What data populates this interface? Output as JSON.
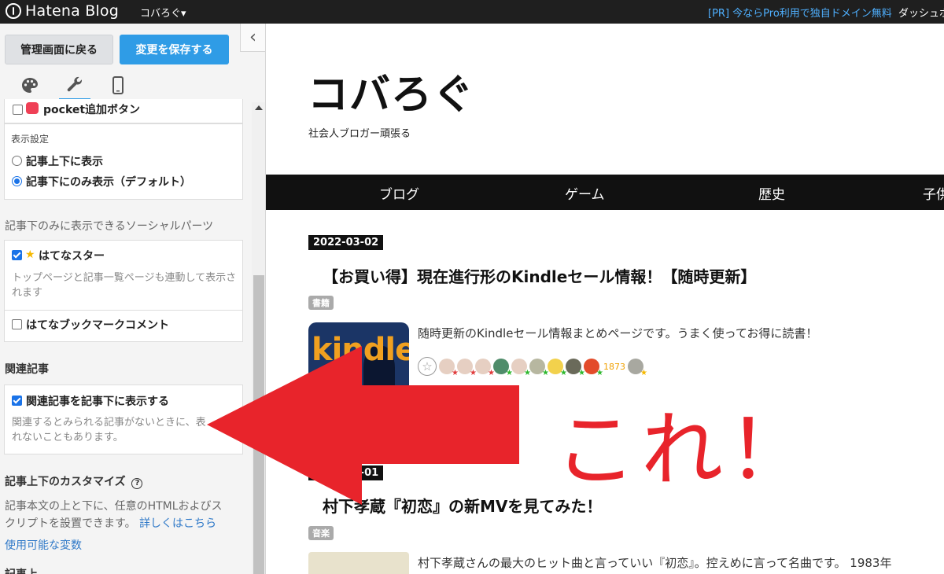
{
  "topbar": {
    "logo_text": "Hatena Blog",
    "blog_switch": "コバろぐ▾",
    "pr_link": "[PR] 今ならPro利用で独自ドメイン無料",
    "dashboard_link": "ダッシュボード"
  },
  "sidebar": {
    "back_button": "管理画面に戻る",
    "save_button": "変更を保存する",
    "collapse_icon": "‹",
    "tabs": [
      {
        "name": "design",
        "icon": "palette-icon"
      },
      {
        "name": "customize",
        "icon": "wrench-icon"
      },
      {
        "name": "smartphone",
        "icon": "smartphone-icon"
      }
    ],
    "pocket_label": "pocket追加ボタン",
    "display_setting_title": "表示設定",
    "radio_top_bottom": "記事上下に表示",
    "radio_bottom_only": "記事下にのみ表示（デフォルト）",
    "social_parts_heading": "記事下のみに表示できるソーシャルパーツ",
    "hatena_star_label": "はてなスター",
    "hatena_star_help": "トップページと記事一覧ページも連動して表示されます",
    "bookmark_comment_label": "はてなブックマークコメント",
    "related_heading": "関連記事",
    "related_label": "関連記事を記事下に表示する",
    "related_help_line1": "関連するとみられる記事がないときに、表",
    "related_help_line2": "れないこともあります。",
    "custom_heading": "記事上下のカスタマイズ",
    "custom_help_icon": "?",
    "custom_desc_line1": "記事本文の上と下に、任意のHTMLおよびス",
    "custom_desc_line2": "クリプトを設置できます。",
    "custom_more_link": "詳しくはこちら",
    "variables_link": "使用可能な変数",
    "partial_bottom": "記事上"
  },
  "blog": {
    "title": "コバろぐ",
    "description": "社会人ブロガー頑張る",
    "nav": [
      "ブログ",
      "ゲーム",
      "歴史",
      "子供"
    ],
    "posts": [
      {
        "date": "2022-03-02",
        "title": "【お買い得】現在進行形のKindleセール情報！【随時更新】",
        "tag": "書籍",
        "thumb_text": "kindle",
        "excerpt": "随時更新のKindleセール情報まとめページです。うまく使ってお得に読書！",
        "star_count": "1873"
      },
      {
        "date": "2022-03-01",
        "title": "村下孝蔵『初恋』の新MVを見てみた！",
        "tag": "音楽",
        "excerpt": "村下孝蔵さんの最大のヒット曲と言っていい『初恋』。控えめに言って名曲です。 1983年"
      }
    ]
  },
  "annotation": {
    "text": "これ！",
    "color": "#e8242b"
  },
  "colors": {
    "accent": "#2f9ce6",
    "topbar": "#1f1f1f",
    "navbar": "#111111",
    "arrow": "#e8242b"
  }
}
